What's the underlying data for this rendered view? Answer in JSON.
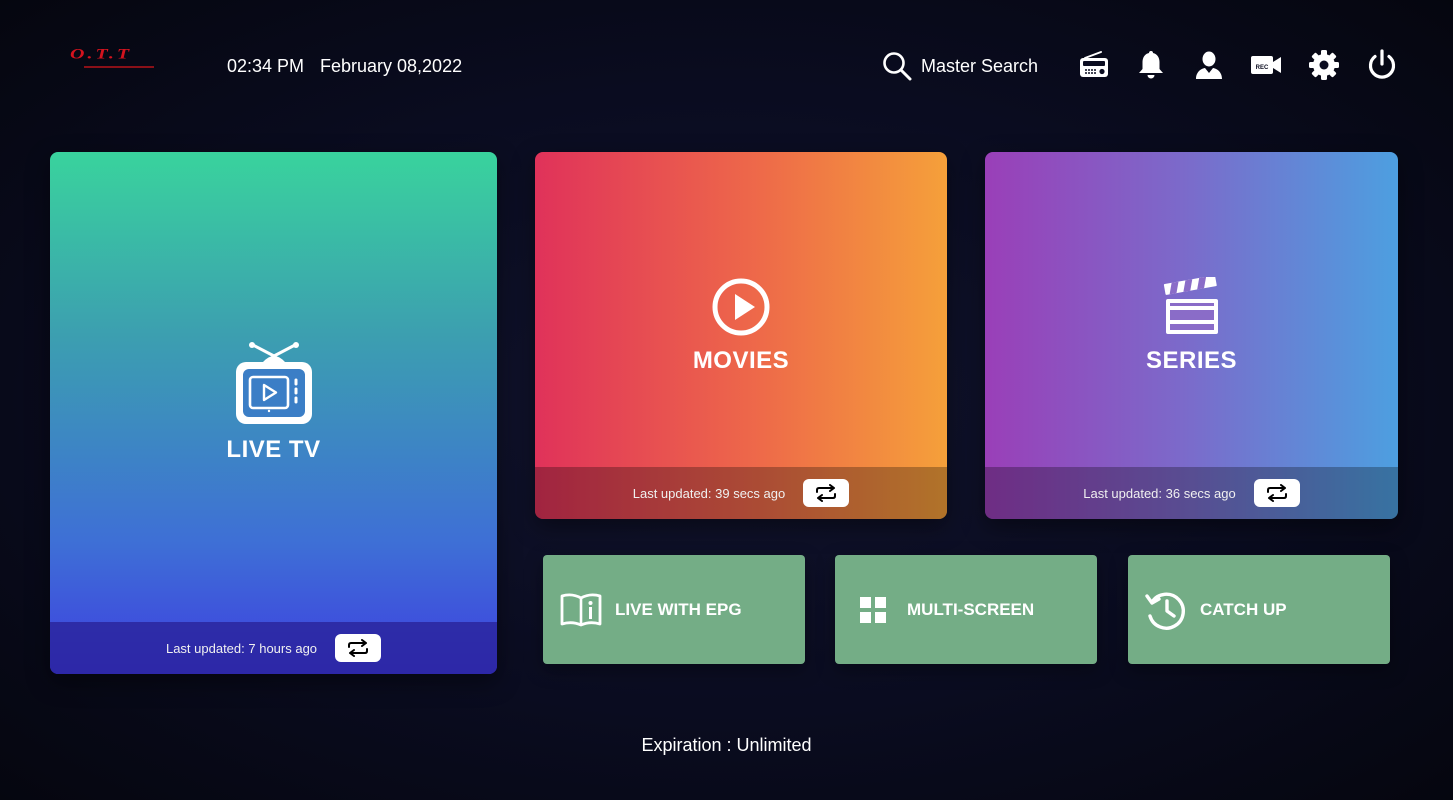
{
  "header": {
    "logo_text": "O.T.T",
    "time": "02:34 PM",
    "date": "February 08,2022",
    "search_label": "Master Search",
    "icons": [
      "radio-icon",
      "bell-icon",
      "user-icon",
      "record-camera-icon",
      "gear-icon",
      "power-icon"
    ],
    "record_badge": "REC"
  },
  "tiles": {
    "live_tv": {
      "title": "LIVE TV",
      "updated": "Last updated: 7 hours ago",
      "icon": "tv-icon"
    },
    "movies": {
      "title": "MOVIES",
      "updated": "Last updated: 39 secs ago",
      "icon": "play-circle-icon"
    },
    "series": {
      "title": "SERIES",
      "updated": "Last updated: 36 secs ago",
      "icon": "clapperboard-icon"
    }
  },
  "sub_tiles": [
    {
      "label": "LIVE WITH EPG",
      "icon": "book-info-icon"
    },
    {
      "label": "MULTI-SCREEN",
      "icon": "grid-icon"
    },
    {
      "label": "CATCH UP",
      "icon": "history-clock-icon"
    }
  ],
  "footer": {
    "expiration": "Expiration : Unlimited"
  },
  "colors": {
    "background": "#0a0c20",
    "logo_red": "#d3131e",
    "sub_tile_green": "#74ad86",
    "live_gradient": [
      "#39d39d",
      "#3d3fe0"
    ],
    "movies_gradient": [
      "#e0325a",
      "#f5a03a"
    ],
    "series_gradient": [
      "#9a3fb8",
      "#4d9fe0"
    ]
  }
}
